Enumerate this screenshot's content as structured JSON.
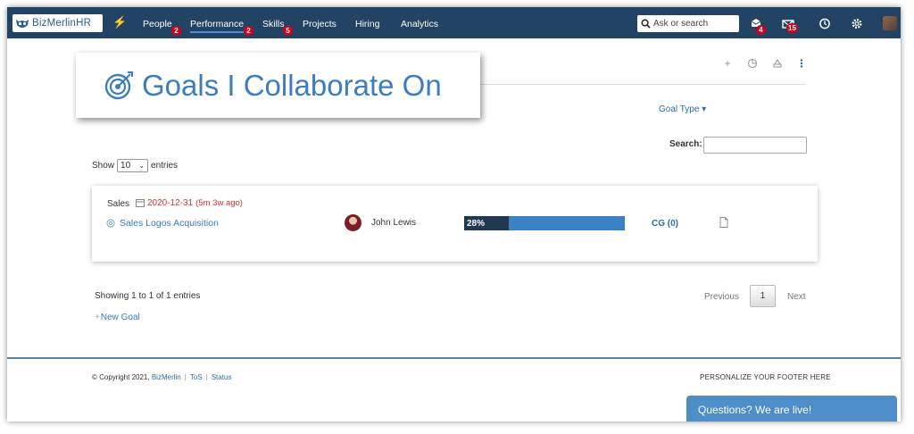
{
  "nav": {
    "logo_text": "BizMerlinHR",
    "items": [
      {
        "label": "People",
        "badge": "2"
      },
      {
        "label": "Performance",
        "badge": "2"
      },
      {
        "label": "Skills",
        "badge": "5"
      },
      {
        "label": "Projects"
      },
      {
        "label": "Hiring"
      },
      {
        "label": "Analytics"
      }
    ],
    "search_placeholder": "Ask or search",
    "inbox_badge": "4",
    "mail_badge": "15"
  },
  "page": {
    "title": "Goals I Collaborate On",
    "goal_type_label": "Goal Type",
    "search_label": "Search:",
    "show_label": "Show",
    "entries_label": "entries",
    "page_length": "10"
  },
  "goal": {
    "category": "Sales",
    "date": "2020-12-31",
    "ago": "(5m 3w ago)",
    "name": "Sales Logos Acquisition",
    "owner": "John Lewis",
    "progress_label": "28%",
    "progress": 0.28,
    "cg_link": "CG (0)"
  },
  "table_footer": {
    "showing": "Showing 1 to 1 of 1 entries",
    "new_goal": "New Goal",
    "previous": "Previous",
    "page": "1",
    "next": "Next"
  },
  "footer": {
    "copyright": "© Copyright 2021,",
    "company_link": "BizMerlin",
    "tos_link": "ToS",
    "status_link": "Status",
    "personalize": "PERSONALIZE YOUR FOOTER HERE",
    "chat": "Questions? We are live!"
  },
  "colors": {
    "nav_bg": "#234364",
    "accent": "#3d7cbf",
    "badge": "#d0021b",
    "progress_track": "#3a82c4",
    "progress_fill": "#213754",
    "date_red": "#d9302c",
    "chat_bg": "#4d8dc8"
  }
}
